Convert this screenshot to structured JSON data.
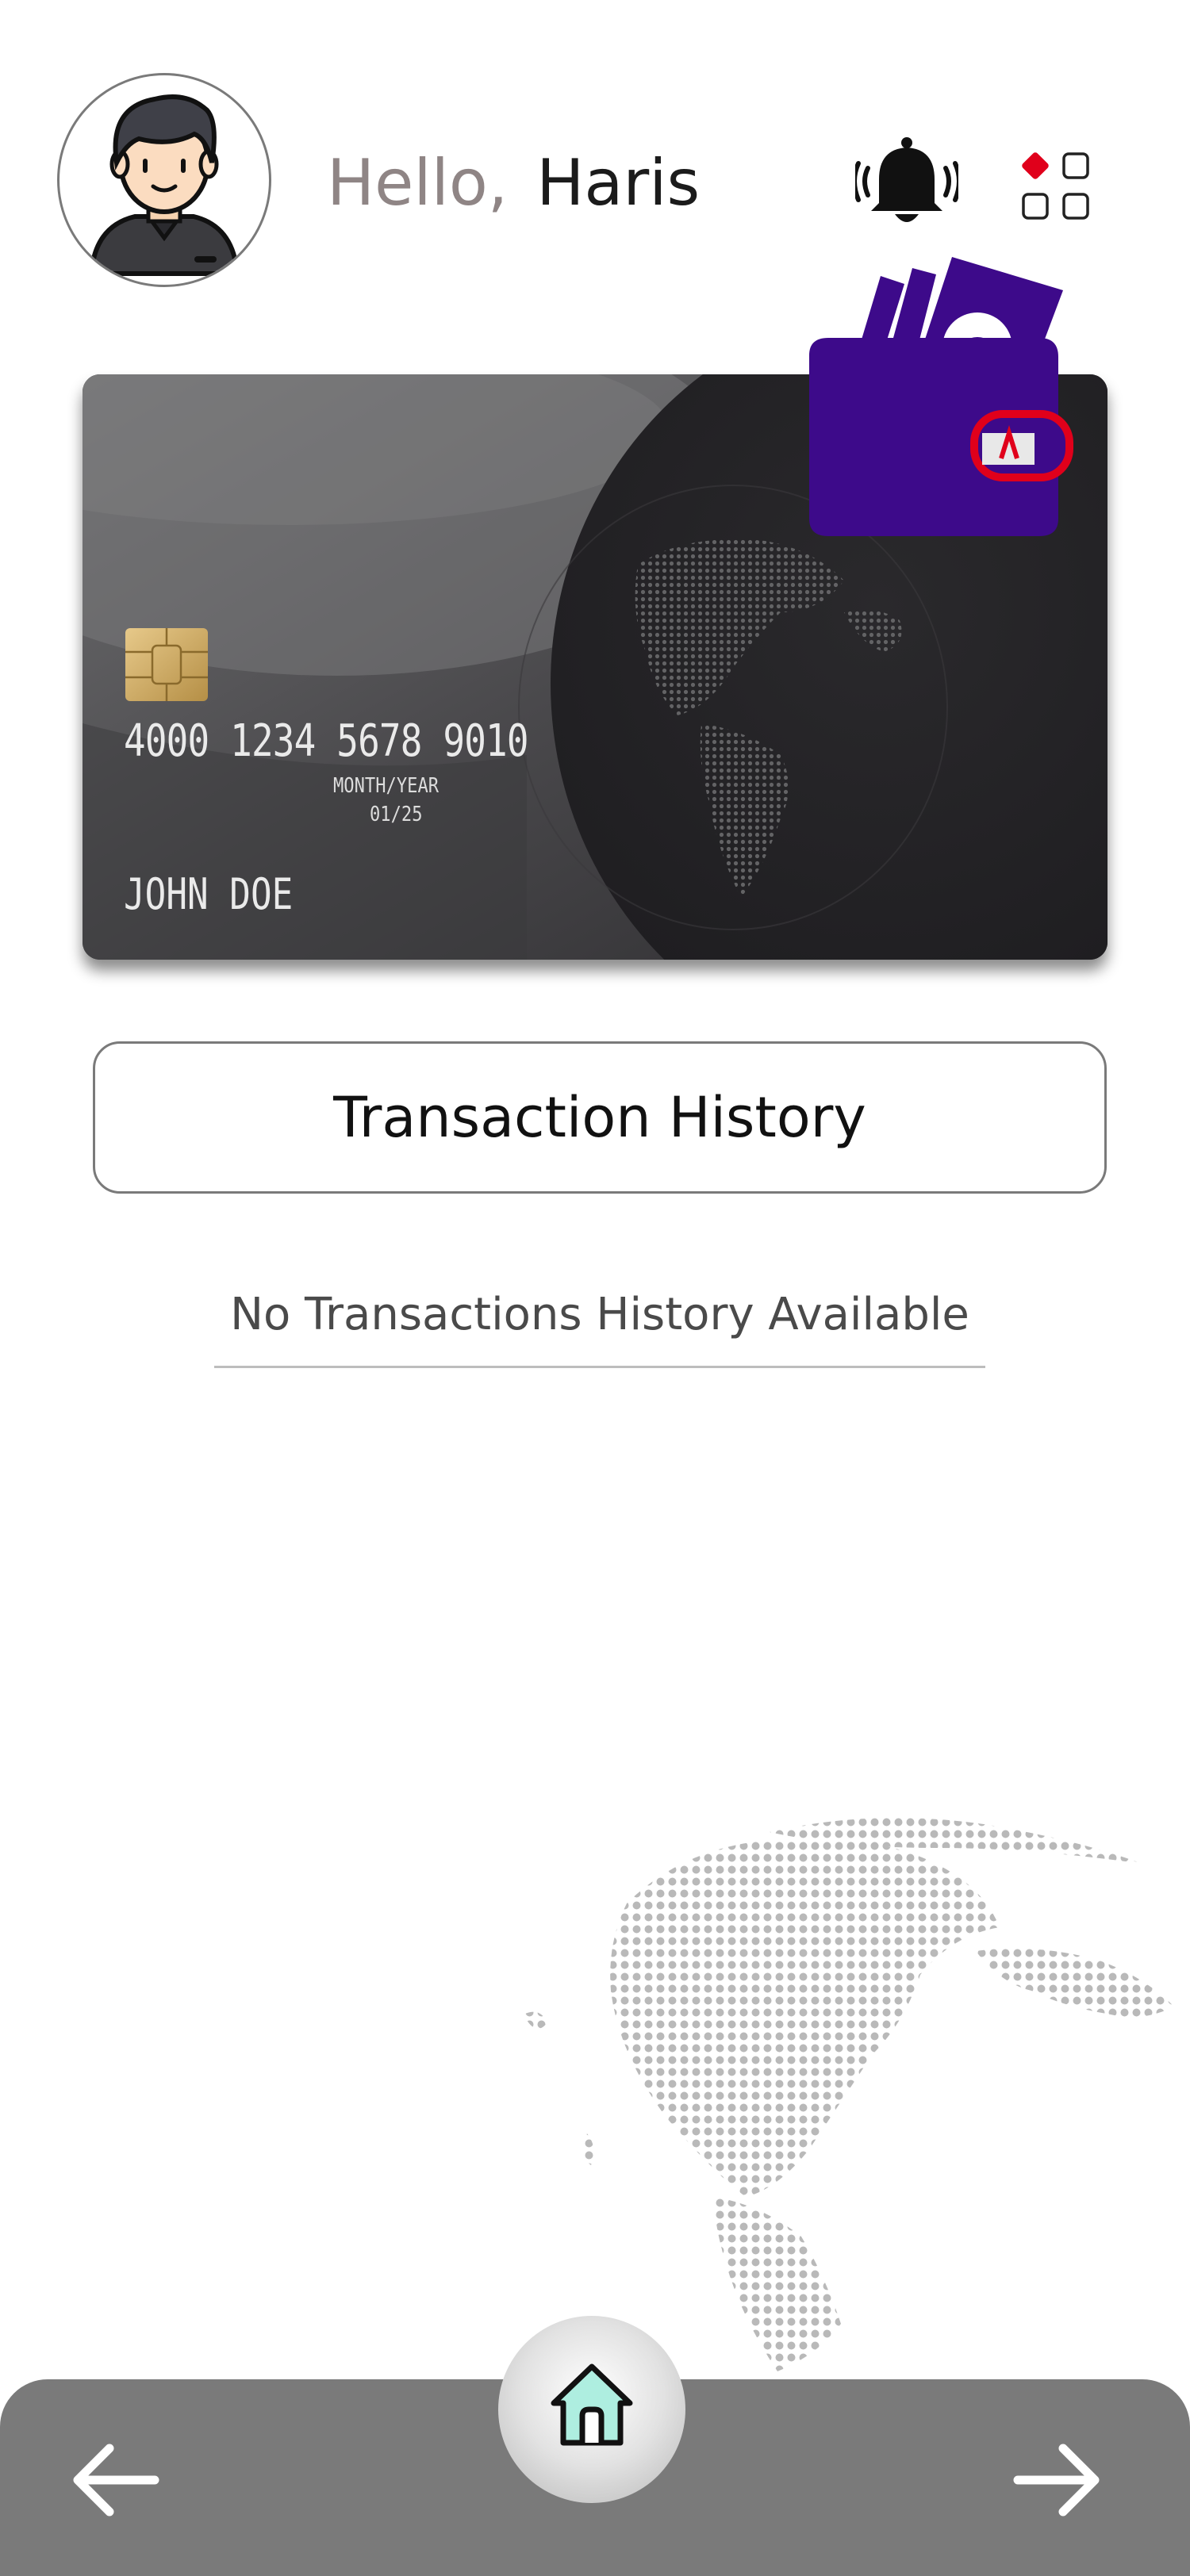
{
  "header": {
    "hello": "Hello,",
    "user_name": "Haris",
    "avatar_icon": "user-avatar-icon",
    "notification_icon": "bell-icon",
    "menu_icon": "apps-grid-icon"
  },
  "card": {
    "number": "4000 1234 5678 9010",
    "expiry_label": "MONTH/YEAR",
    "expiry": "01/25",
    "holder": "JOHN DOE",
    "logo": "wallet-logo-icon"
  },
  "history": {
    "button_label": "Transaction History",
    "empty_message": "No Transactions History Available"
  },
  "nav": {
    "back_icon": "arrow-left-icon",
    "home_icon": "home-icon",
    "forward_icon": "arrow-right-icon"
  },
  "colors": {
    "accent_red": "#e0001b",
    "wallet_purple": "#3d0a8a",
    "nav_gray": "#7a7a7a",
    "home_teal": "#aeeee0"
  }
}
